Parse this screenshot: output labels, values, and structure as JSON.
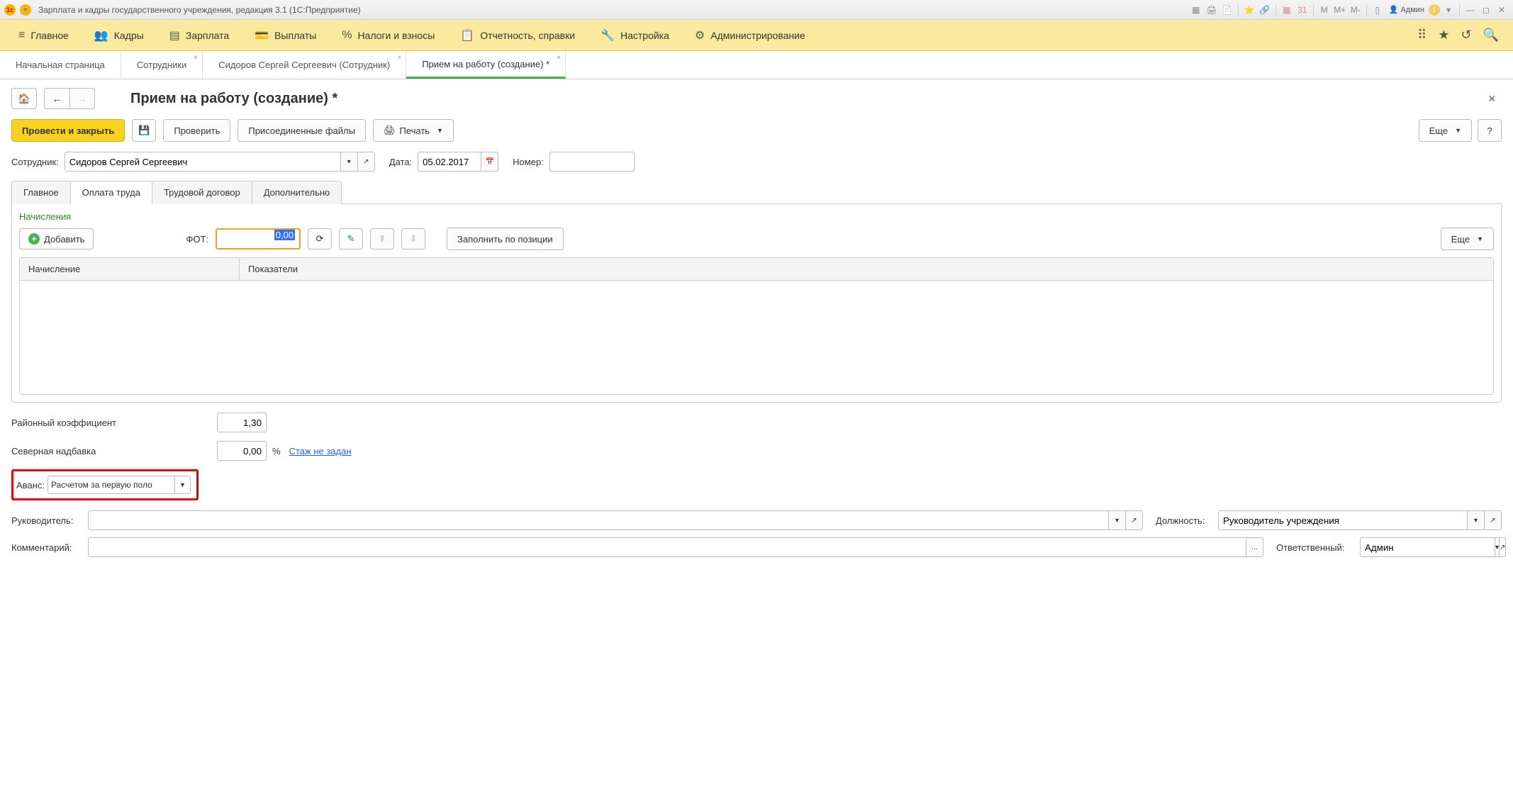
{
  "titlebar": {
    "title": "Зарплата и кадры государственного учреждения, редакция 3.1  (1С:Предприятие)",
    "user": "Админ"
  },
  "mainmenu": {
    "items": [
      {
        "icon": "≡",
        "label": "Главное"
      },
      {
        "icon": "👥",
        "label": "Кадры"
      },
      {
        "icon": "▤",
        "label": "Зарплата"
      },
      {
        "icon": "💳",
        "label": "Выплаты"
      },
      {
        "icon": "%",
        "label": "Налоги и взносы"
      },
      {
        "icon": "📋",
        "label": "Отчетность, справки"
      },
      {
        "icon": "🔧",
        "label": "Настройка"
      },
      {
        "icon": "⚙",
        "label": "Администрирование"
      }
    ]
  },
  "tabs": [
    {
      "label": "Начальная страница",
      "closable": false
    },
    {
      "label": "Сотрудники",
      "closable": true
    },
    {
      "label": "Сидоров Сергей Сергеевич (Сотрудник)",
      "closable": true
    },
    {
      "label": "Прием на работу (создание) *",
      "closable": true,
      "active": true
    }
  ],
  "page": {
    "title": "Прием на работу (создание) *"
  },
  "toolbar": {
    "submit": "Провести и закрыть",
    "check": "Проверить",
    "files": "Присоединенные файлы",
    "print": "Печать",
    "more": "Еще"
  },
  "form": {
    "employee_label": "Сотрудник:",
    "employee_value": "Сидоров Сергей Сергеевич",
    "date_label": "Дата:",
    "date_value": "05.02.2017",
    "number_label": "Номер:",
    "number_value": ""
  },
  "subtabs": [
    {
      "label": "Главное"
    },
    {
      "label": "Оплата труда",
      "active": true
    },
    {
      "label": "Трудовой договор"
    },
    {
      "label": "Дополнительно"
    }
  ],
  "panel": {
    "title": "Начисления",
    "add": "Добавить",
    "fot_label": "ФОТ:",
    "fot_value": "0,00",
    "fill": "Заполнить по позиции",
    "more": "Еще",
    "cols": {
      "c1": "Начисление",
      "c2": "Показатели"
    }
  },
  "fields": {
    "rk_label": "Районный коэффициент",
    "rk_value": "1,30",
    "sn_label": "Северная надбавка",
    "sn_value": "0,00",
    "sn_unit": "%",
    "staz_link": "Стаж не задан",
    "avans_label": "Аванс:",
    "avans_value": "Расчетом за первую поло"
  },
  "bottom": {
    "ruk_label": "Руководитель:",
    "ruk_value": "",
    "dolzh_label": "Должность:",
    "dolzh_value": "Руководитель учреждения",
    "comm_label": "Комментарий:",
    "comm_value": "",
    "otv_label": "Ответственный:",
    "otv_value": "Админ"
  }
}
